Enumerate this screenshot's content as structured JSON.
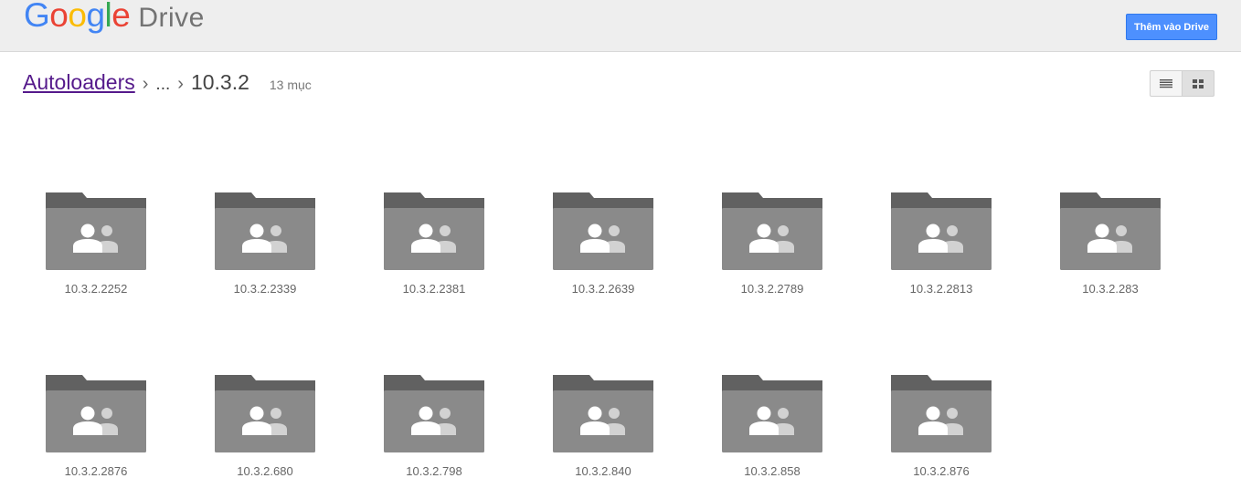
{
  "header": {
    "logo_letters": [
      {
        "char": "G",
        "color": "#4285f4"
      },
      {
        "char": "o",
        "color": "#ea4335"
      },
      {
        "char": "o",
        "color": "#fbbc05"
      },
      {
        "char": "g",
        "color": "#4285f4"
      },
      {
        "char": "l",
        "color": "#34a853"
      },
      {
        "char": "e",
        "color": "#ea4335"
      }
    ],
    "product_name": "Drive",
    "add_button_label": "Thêm vào Drive"
  },
  "breadcrumb": {
    "root": "Autoloaders",
    "separator": "›",
    "ellipsis": "...",
    "current": "10.3.2",
    "item_count": "13 mục"
  },
  "view_toggle": {
    "list_icon": "list-view-icon",
    "grid_icon": "grid-view-icon",
    "active": "grid"
  },
  "folders": [
    {
      "name": "10.3.2.2252"
    },
    {
      "name": "10.3.2.2339"
    },
    {
      "name": "10.3.2.2381"
    },
    {
      "name": "10.3.2.2639"
    },
    {
      "name": "10.3.2.2789"
    },
    {
      "name": "10.3.2.2813"
    },
    {
      "name": "10.3.2.283"
    },
    {
      "name": "10.3.2.2876"
    },
    {
      "name": "10.3.2.680"
    },
    {
      "name": "10.3.2.798"
    },
    {
      "name": "10.3.2.840"
    },
    {
      "name": "10.3.2.858"
    },
    {
      "name": "10.3.2.876"
    }
  ],
  "colors": {
    "folder_tab": "#616161",
    "folder_body": "#8a8a8a",
    "person_front": "#ffffff",
    "person_back": "#d2d2d2",
    "accent": "#4d90fe"
  },
  "folder_icon": "shared-folder-icon"
}
